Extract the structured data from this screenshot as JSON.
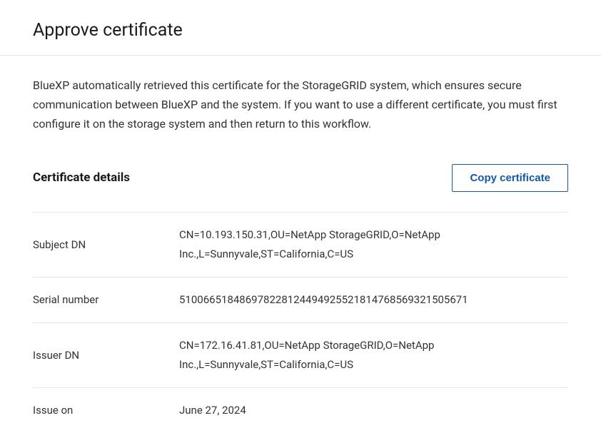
{
  "header": {
    "title": "Approve certificate"
  },
  "description": "BlueXP automatically retrieved this certificate for the StorageGRID system, which ensures secure communication between BlueXP and the system. If you want to use a different certificate, you must first configure it on the storage system and then return to this workflow.",
  "details": {
    "section_title": "Certificate details",
    "copy_button_label": "Copy certificate",
    "rows": [
      {
        "label": "Subject DN",
        "value": "CN=10.193.150.31,OU=NetApp StorageGRID,O=NetApp Inc.,L=Sunnyvale,ST=California,C=US"
      },
      {
        "label": "Serial number",
        "value": "510066518486978228124494925521814768569321505671"
      },
      {
        "label": "Issuer DN",
        "value": "CN=172.16.41.81,OU=NetApp StorageGRID,O=NetApp Inc.,L=Sunnyvale,ST=California,C=US"
      },
      {
        "label": "Issue on",
        "value": "June 27, 2024"
      }
    ]
  }
}
